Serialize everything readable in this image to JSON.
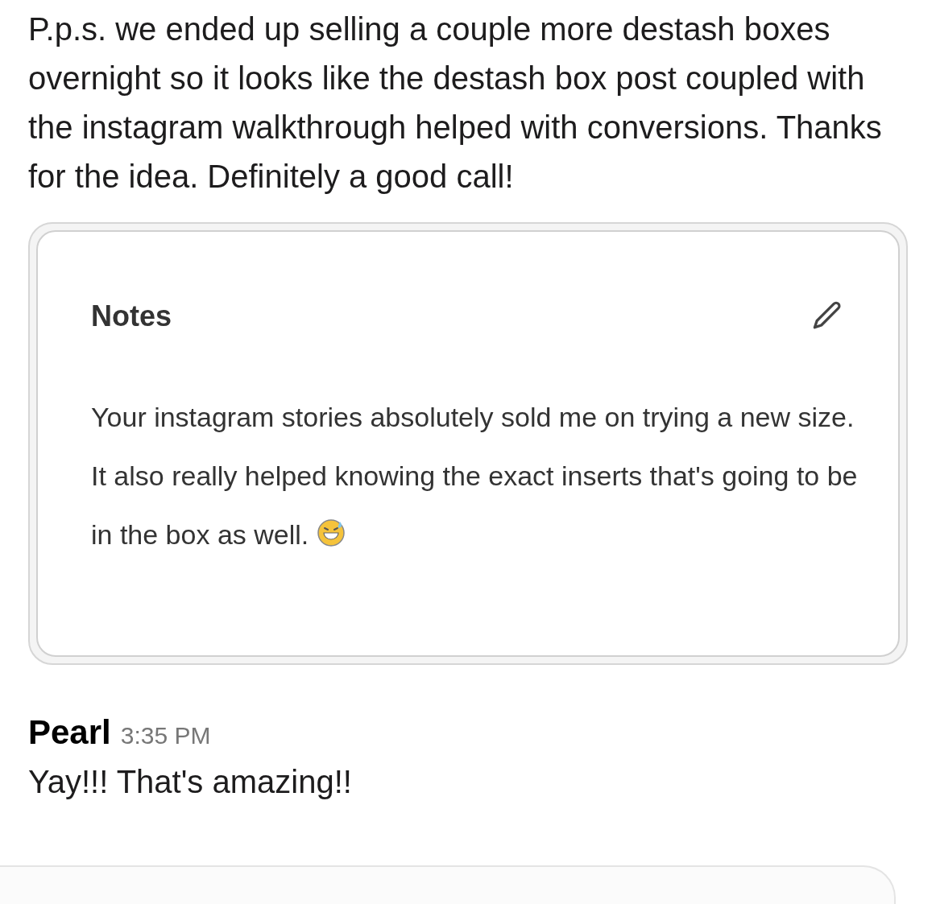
{
  "message": {
    "text": "P.p.s. we ended up selling a couple more destash boxes overnight so it looks like the destash box post coupled with the instagram walkthrough helped with conversions. Thanks for the idea. Definitely a good call!"
  },
  "attachment": {
    "title": "Notes",
    "body": "Your instagram stories absolutely sold me on trying a new size. It also really helped knowing the exact inserts that's going to be in the box as well."
  },
  "reply": {
    "sender": "Pearl",
    "time": "3:35 PM",
    "text": "Yay!!! That's amazing!!"
  }
}
